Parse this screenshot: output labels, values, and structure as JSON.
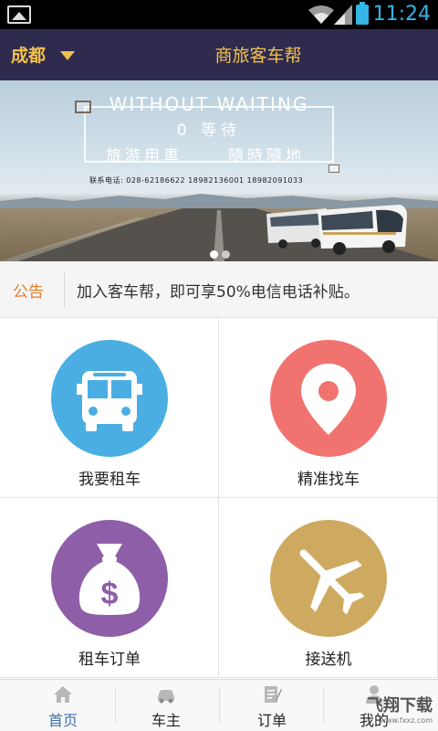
{
  "status_bar": {
    "time": "11:24"
  },
  "header": {
    "city": "成都",
    "title": "商旅客车帮"
  },
  "banner": {
    "headline": "WITHOUT WAITING",
    "line1": "0 等待",
    "line2a": "旅游用車",
    "line2b": "隨時隨地",
    "phone": "联系电话: 028-62186622    18982136001    18982091033",
    "dots": 2,
    "active_dot": 0
  },
  "notice": {
    "label": "公告",
    "text": "加入客车帮，即可享50%电信电话补贴。"
  },
  "grid": [
    {
      "label": "我要租车",
      "icon": "bus-icon",
      "color": "#4aaee2"
    },
    {
      "label": "精准找车",
      "icon": "location-pin-icon",
      "color": "#f1736f"
    },
    {
      "label": "租车订单",
      "icon": "money-bag-icon",
      "color": "#8e5ea8"
    },
    {
      "label": "接送机",
      "icon": "airplane-icon",
      "color": "#ceaa61"
    }
  ],
  "bottom_nav": [
    {
      "label": "首页",
      "icon": "home-icon",
      "active": true
    },
    {
      "label": "车主",
      "icon": "car-icon",
      "active": false
    },
    {
      "label": "订单",
      "icon": "order-icon",
      "active": false
    },
    {
      "label": "我的",
      "icon": "user-icon",
      "active": false
    }
  ],
  "watermark": {
    "text": "飞翔下载",
    "url": "www.fxxz.com"
  }
}
